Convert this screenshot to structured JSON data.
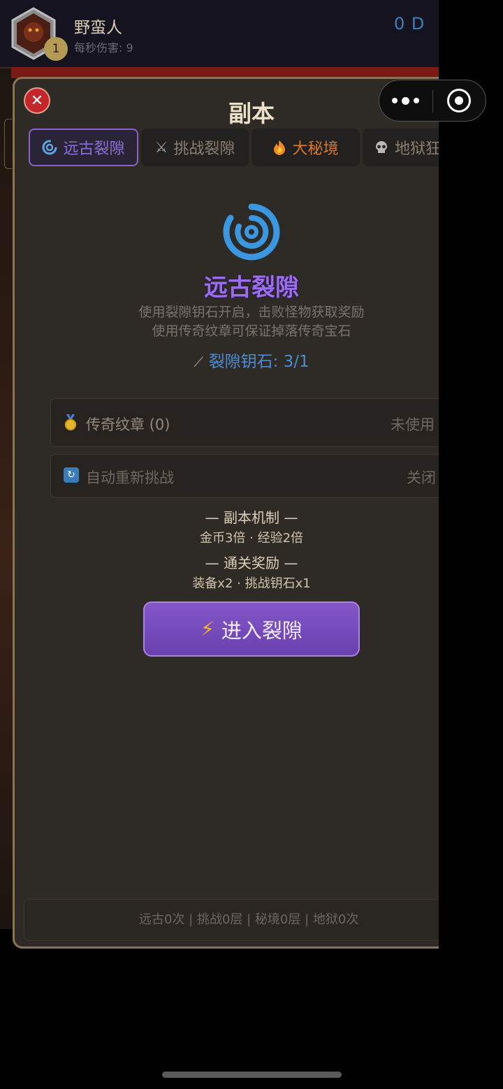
{
  "player": {
    "name": "野蛮人",
    "level": "1",
    "dps_label": "每秒伤害: 9",
    "currency": "0 D"
  },
  "modal": {
    "title": "副本",
    "close_symbol": "✕"
  },
  "tabs": [
    {
      "label": "远古裂隙",
      "icon": "swirl-icon",
      "active": true
    },
    {
      "label": "挑战裂隙",
      "icon": "crossed-swords-icon",
      "active": false
    },
    {
      "label": "大秘境",
      "icon": "fire-icon",
      "active": false
    },
    {
      "label": "地狱狂",
      "icon": "skull-icon",
      "active": false
    }
  ],
  "rift": {
    "title": "远古裂隙",
    "desc_line1": "使用裂隙钥石开启，击败怪物获取奖励",
    "desc_line2": "使用传奇纹章可保证掉落传奇宝石",
    "key_label": "裂隙钥石: 3/1"
  },
  "options": {
    "legend_seal": {
      "label": "传奇纹章 (0)",
      "value": "未使用"
    },
    "auto_retry": {
      "label": "自动重新挑战",
      "value": "关闭"
    }
  },
  "mechanics": {
    "heading": "— 副本机制 —",
    "text": "金币3倍 · 经验2倍"
  },
  "rewards": {
    "heading": "— 通关奖励 —",
    "text": "装备x2 · 挑战钥石x1"
  },
  "enter_button": {
    "label": "进入裂隙"
  },
  "footer": {
    "stats": "远古0次 | 挑战0层 | 秘境0层 | 地狱0次"
  },
  "colors": {
    "accent_purple": "#8c6fe0",
    "key_blue": "#4f8bd0",
    "close_red": "#c4262a",
    "button_purple": "#7448b8"
  }
}
